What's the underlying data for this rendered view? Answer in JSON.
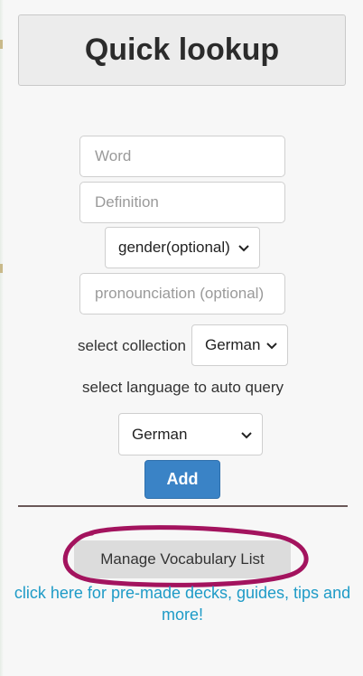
{
  "page": {
    "title": "Quick lookup"
  },
  "form": {
    "word_placeholder": "Word",
    "definition_placeholder": "Definition",
    "gender_select": "gender(optional)",
    "pronunciation_placeholder": "pronounciation (optional)",
    "collection_label": "select collection",
    "collection_value": "German",
    "language_label": "select language to auto query",
    "language_value": "German",
    "add_label": "Add"
  },
  "manage": {
    "label": "Manage Vocabulary List"
  },
  "resources_link": {
    "text": "click here for pre-made decks, guides, tips and more!"
  },
  "colors": {
    "accent_button": "#3a83c6",
    "link": "#1e9bc7",
    "annotation_stroke": "#a3135e",
    "divider": "#6a5858"
  },
  "icons": {
    "dropdown": "chevron-down-icon",
    "annotation": "hand-drawn-circle"
  }
}
